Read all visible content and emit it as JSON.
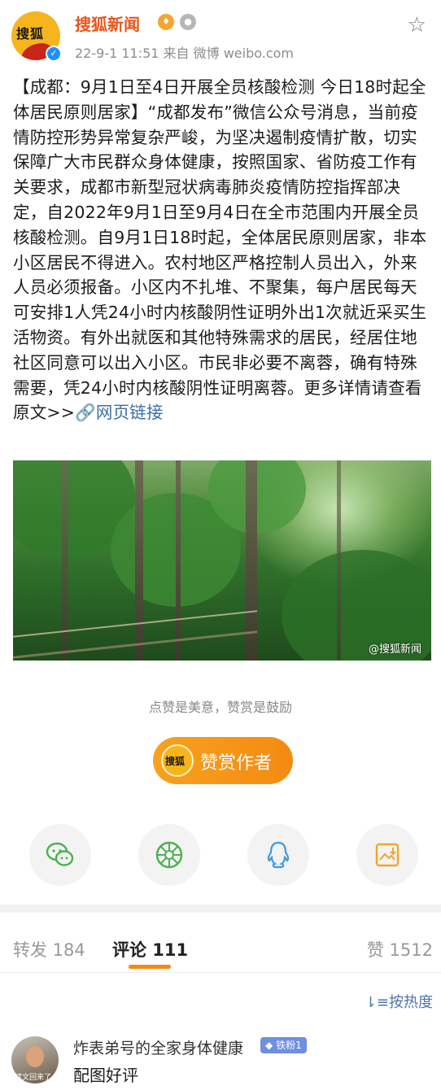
{
  "post": {
    "author": "搜狐新闻",
    "avatar_text": "搜狐",
    "meta": "22-9-1 11:51  来自 微博 weibo.com",
    "content": "【成都：9月1日至4日开展全员核酸检测 今日18时起全体居民原则居家】“成都发布”微信公众号消息，当前疫情防控形势异常复杂严峻，为坚决遏制疫情扩散，切实保障广大市民群众身体健康，按照国家、省防疫工作有关要求，成都市新型冠状病毒肺炎疫情防控指挥部决定，自2022年9月1日至9月4日在全市范围内开展全员核酸检测。自9月1日18时起，全体居民原则居家，非本小区居民不得进入。农村地区严格控制人员出入，外来人员必须报备。小区内不扎堆、不聚集，每户居民每天可安排1人凭24小时内核酸阴性证明外出1次就近采买生活物资。有外出就医和其他特殊需求的居民，经居住地社区同意可以出入小区。市民非必要不离蓉，确有特殊需要，凭24小时内核酸阴性证明离蓉。更多详情请查看原文>>",
    "link_text": "网页链接",
    "image_watermark": "@搜狐新闻"
  },
  "reward": {
    "hint": "点赞是美意，赞赏是鼓励",
    "button_label": "赞赏作者",
    "button_icon_text": "搜狐"
  },
  "share_icons": [
    "wechat-icon",
    "moments-icon",
    "qq-icon",
    "save-image-icon"
  ],
  "tabs": {
    "repost": "转发 184",
    "comments": "评论 111",
    "likes": "赞 1512"
  },
  "sort_label": "按热度",
  "comment": {
    "user": "炸表弟号的全家身体健康",
    "badge": "铁粉1",
    "text": "配图好评",
    "avatar_caption": "斌文回来了"
  },
  "colors": {
    "brand_orange": "#f48a12",
    "author_name": "#e8561b",
    "link_blue": "#3b6fa8"
  }
}
